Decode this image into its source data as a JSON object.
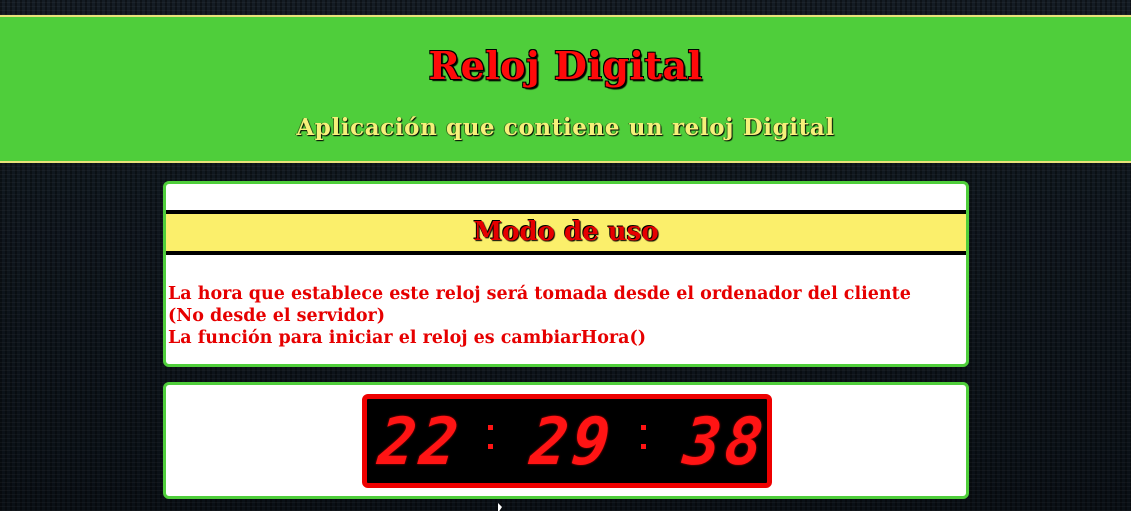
{
  "header": {
    "title": "Reloj Digital",
    "subtitle": "Aplicación que contiene un reloj Digital"
  },
  "usage": {
    "title": "Modo de uso",
    "lines": [
      "La hora que establece este reloj será tomada desde el ordenador del cliente",
      "(No desde el servidor)",
      "La función para iniciar el reloj es cambiarHora()"
    ]
  },
  "clock": {
    "hours": "22",
    "minutes": "29",
    "seconds": "38"
  },
  "colors": {
    "header_bg": "#4fce3b",
    "title_red": "#ff0a0a",
    "subtitle_yellow": "#f6f07a",
    "usage_bar": "#fbef6b",
    "clock_digit": "#ff1414"
  }
}
